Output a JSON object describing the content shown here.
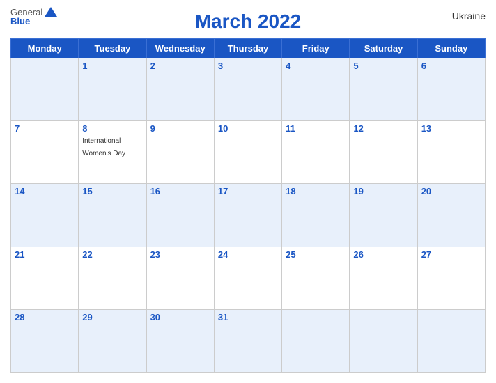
{
  "header": {
    "title": "March 2022",
    "country": "Ukraine",
    "logo_general": "General",
    "logo_blue": "Blue"
  },
  "weekdays": [
    "Monday",
    "Tuesday",
    "Wednesday",
    "Thursday",
    "Friday",
    "Saturday",
    "Sunday"
  ],
  "weeks": [
    [
      {
        "day": "",
        "empty": true
      },
      {
        "day": "1"
      },
      {
        "day": "2"
      },
      {
        "day": "3"
      },
      {
        "day": "4"
      },
      {
        "day": "5"
      },
      {
        "day": "6"
      }
    ],
    [
      {
        "day": "7"
      },
      {
        "day": "8",
        "event": "International Women's Day"
      },
      {
        "day": "9"
      },
      {
        "day": "10"
      },
      {
        "day": "11"
      },
      {
        "day": "12"
      },
      {
        "day": "13"
      }
    ],
    [
      {
        "day": "14"
      },
      {
        "day": "15"
      },
      {
        "day": "16"
      },
      {
        "day": "17"
      },
      {
        "day": "18"
      },
      {
        "day": "19"
      },
      {
        "day": "20"
      }
    ],
    [
      {
        "day": "21"
      },
      {
        "day": "22"
      },
      {
        "day": "23"
      },
      {
        "day": "24"
      },
      {
        "day": "25"
      },
      {
        "day": "26"
      },
      {
        "day": "27"
      }
    ],
    [
      {
        "day": "28"
      },
      {
        "day": "29"
      },
      {
        "day": "30"
      },
      {
        "day": "31"
      },
      {
        "day": "",
        "empty": true
      },
      {
        "day": "",
        "empty": true
      },
      {
        "day": "",
        "empty": true
      }
    ]
  ]
}
